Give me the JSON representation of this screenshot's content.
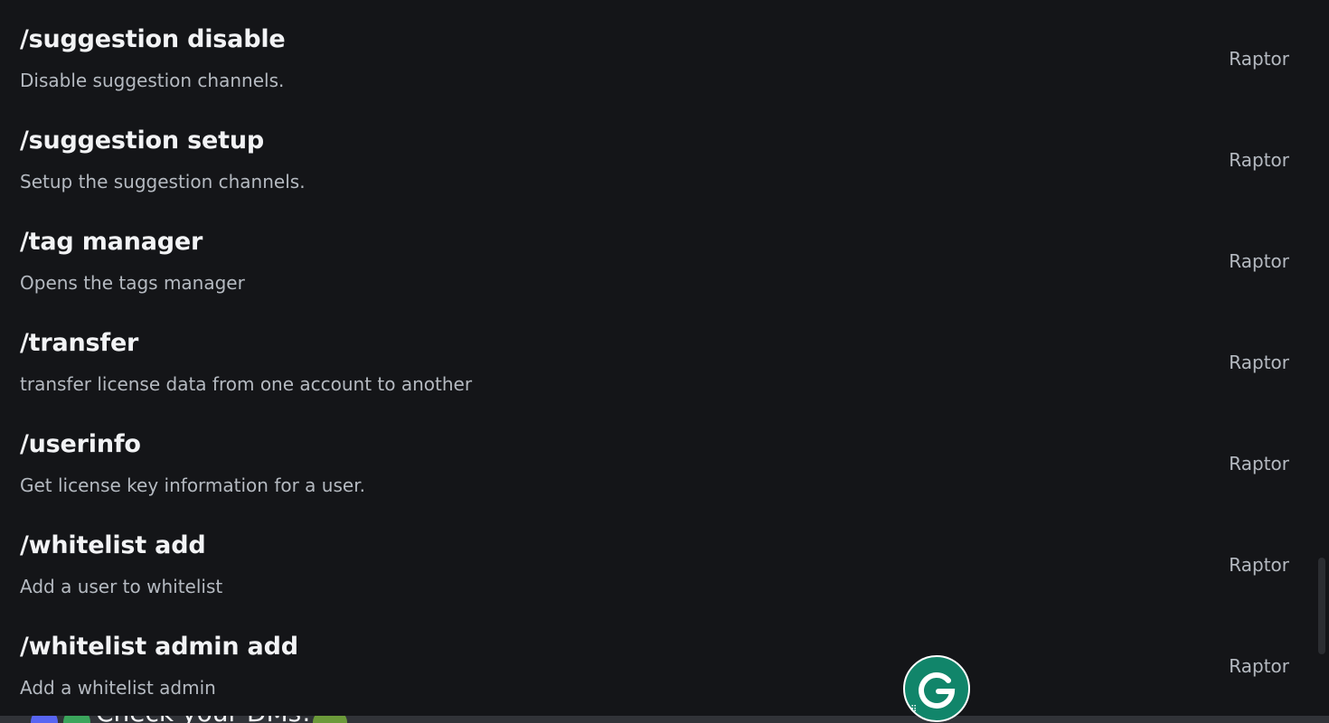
{
  "commands": [
    {
      "name": "/suggestion disable",
      "description": "Disable suggestion channels.",
      "source": "Raptor"
    },
    {
      "name": "/suggestion setup",
      "description": "Setup the suggestion channels.",
      "source": "Raptor"
    },
    {
      "name": "/tag manager",
      "description": "Opens the tags manager",
      "source": "Raptor"
    },
    {
      "name": "/transfer",
      "description": "transfer license data from one account to another",
      "source": "Raptor"
    },
    {
      "name": "/userinfo",
      "description": "Get license key information for a user.",
      "source": "Raptor"
    },
    {
      "name": "/whitelist add",
      "description": "Add a user to whitelist",
      "source": "Raptor"
    },
    {
      "name": "/whitelist admin add",
      "description": "Add a whitelist admin",
      "source": "Raptor"
    }
  ],
  "background_message": {
    "text": "Check your DMs!"
  },
  "grammarly_button": {
    "icon": "grammarly-g-icon",
    "color": "#11856a"
  },
  "colors": {
    "background": "#141518",
    "command_name": "#f2f3f5",
    "description": "#b5bac1"
  }
}
